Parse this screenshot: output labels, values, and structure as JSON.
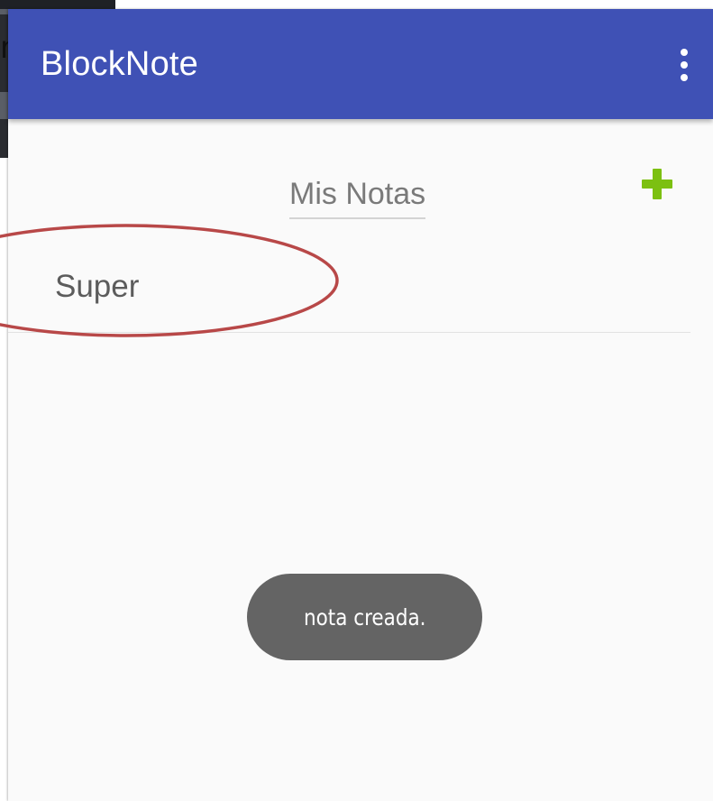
{
  "app_bar": {
    "title": "BlockNote",
    "overflow_icon": "more-vert-icon",
    "background_color": "#3f51b5"
  },
  "content": {
    "section_title": "Mis Notas",
    "add_icon": "plus-icon",
    "add_icon_color": "#7cc011",
    "notes": [
      {
        "label": "Super"
      }
    ]
  },
  "toast": {
    "message": "nota creada."
  },
  "annotation": {
    "shape": "ellipse",
    "color": "#b84848",
    "target": "first-note"
  },
  "background_window": {
    "glyph": "m"
  }
}
